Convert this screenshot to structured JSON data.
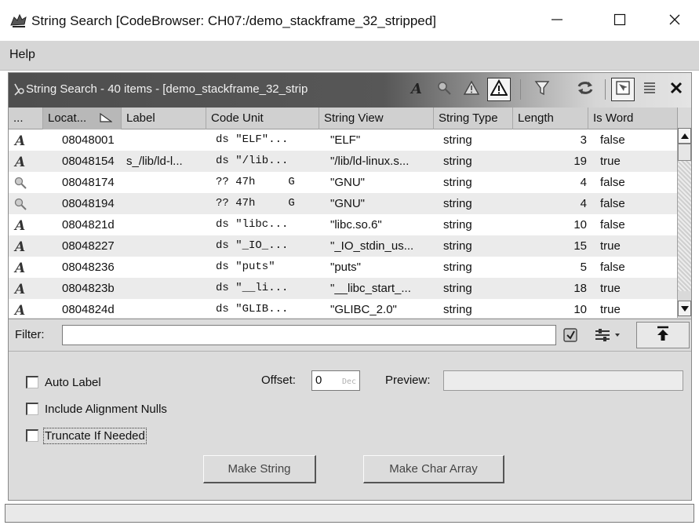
{
  "window": {
    "title": "String Search [CodeBrowser: CH07:/demo_stackframe_32_stripped]",
    "controls": [
      "minimize-icon",
      "maximize-icon",
      "close-icon"
    ]
  },
  "menubar": {
    "items": [
      "Help"
    ]
  },
  "component": {
    "title": "String Search - 40 items - [demo_stackframe_32_strip",
    "toolbar_icons": [
      "show-defined-strings-icon",
      "show-undefined-strings-icon",
      "show-partial-defined-icon",
      "show-conflicting-icon",
      "filter-icon",
      "refresh-icon",
      "make-selection-icon",
      "table-options-icon",
      "close-icon"
    ]
  },
  "table": {
    "headers": [
      "...",
      "Locat...",
      "Label",
      "Code Unit",
      "String View",
      "String Type",
      "Length",
      "Is Word"
    ],
    "sorted_column": "Locat...",
    "rows": [
      {
        "icon": "defined-string-icon",
        "location": "08048001",
        "label": "",
        "code_unit": "ds \"ELF\"...",
        "string_view": "\"ELF\"",
        "string_type": "string",
        "length": "3",
        "is_word": "false"
      },
      {
        "icon": "defined-string-icon",
        "location": "08048154",
        "label": "s_/lib/ld-l...",
        "code_unit": "ds \"/lib...",
        "string_view": "\"/lib/ld-linux.s...",
        "string_type": "string",
        "length": "19",
        "is_word": "true"
      },
      {
        "icon": "undefined-string-icon",
        "location": "08048174",
        "label": "",
        "code_unit": "?? 47h     G",
        "string_view": "\"GNU\"",
        "string_type": "string",
        "length": "4",
        "is_word": "false"
      },
      {
        "icon": "undefined-string-icon",
        "location": "08048194",
        "label": "",
        "code_unit": "?? 47h     G",
        "string_view": "\"GNU\"",
        "string_type": "string",
        "length": "4",
        "is_word": "false"
      },
      {
        "icon": "defined-string-icon",
        "location": "0804821d",
        "label": "",
        "code_unit": "ds \"libc...",
        "string_view": "\"libc.so.6\"",
        "string_type": "string",
        "length": "10",
        "is_word": "false"
      },
      {
        "icon": "defined-string-icon",
        "location": "08048227",
        "label": "",
        "code_unit": "ds \"_IO_...",
        "string_view": "\"_IO_stdin_us...",
        "string_type": "string",
        "length": "15",
        "is_word": "true"
      },
      {
        "icon": "defined-string-icon",
        "location": "08048236",
        "label": "",
        "code_unit": "ds \"puts\"",
        "string_view": "\"puts\"",
        "string_type": "string",
        "length": "5",
        "is_word": "false"
      },
      {
        "icon": "defined-string-icon",
        "location": "0804823b",
        "label": "",
        "code_unit": "ds \"__li...",
        "string_view": "\"__libc_start_...",
        "string_type": "string",
        "length": "18",
        "is_word": "true"
      },
      {
        "icon": "defined-string-icon",
        "location": "0804824d",
        "label": "",
        "code_unit": "ds \"GLIB...",
        "string_view": "\"GLIBC_2.0\"",
        "string_type": "string",
        "length": "10",
        "is_word": "true"
      }
    ]
  },
  "filter": {
    "label": "Filter:",
    "value": ""
  },
  "options": {
    "auto_label": "Auto Label",
    "include_alignment_nulls": "Include Alignment Nulls",
    "truncate_if_needed": "Truncate If Needed",
    "offset_label": "Offset:",
    "offset_value": "0",
    "offset_hint": "Dec",
    "preview_label": "Preview:",
    "preview_value": "",
    "make_string": "Make String",
    "make_char_array": "Make Char Array"
  },
  "statusbar": {
    "text": ""
  }
}
